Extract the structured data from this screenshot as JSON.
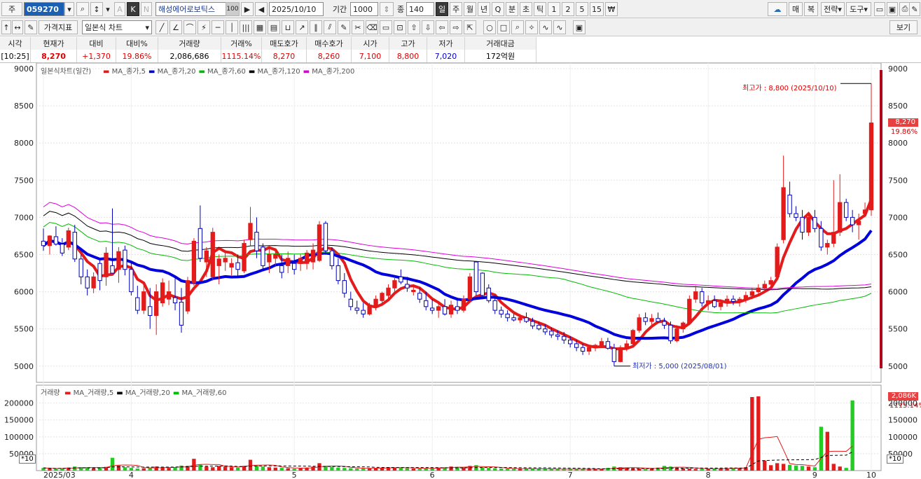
{
  "toolbar1": {
    "mode": "주",
    "code": "059270",
    "stock_name": "해성에어로보틱스",
    "name_badge": "100",
    "date": "2025/10/10",
    "period_label": "기간",
    "period_value": "1000",
    "count_label": "종",
    "count_value": "140",
    "intervals": [
      "일",
      "주",
      "월",
      "년",
      "분",
      "초",
      "틱",
      "1",
      "2",
      "5",
      "15"
    ],
    "active_interval": "일",
    "q_label": "Q",
    "right_buttons": [
      "매",
      "복",
      "전략",
      "도구"
    ]
  },
  "toolbar2": {
    "price_indicator_label": "가격지표",
    "chart_type_value": "일본식 차트",
    "view_label": "보기"
  },
  "quote": {
    "headers": [
      "시각",
      "현재가",
      "대비",
      "대비%",
      "거래량",
      "거래%",
      "매도호가",
      "매수호가",
      "시가",
      "고가",
      "저가",
      "거래대금"
    ],
    "values": [
      "[10:25]",
      "8,270",
      "+1,370",
      "19.86%",
      "2,086,686",
      "1115.14%",
      "8,270",
      "8,260",
      "7,100",
      "8,800",
      "7,020",
      "172억원"
    ],
    "colors": [
      "#000000",
      "#e00000",
      "#e00000",
      "#e00000",
      "#000000",
      "#e00000",
      "#e00000",
      "#e00000",
      "#e00000",
      "#e00000",
      "#0000d0",
      "#000000"
    ]
  },
  "price_chart": {
    "legend_title": "일본식차트(일간)",
    "ma_legend": [
      {
        "label": "MA_종가,5",
        "color": "#e41b1b"
      },
      {
        "label": "MA_종가,20",
        "color": "#0000dd"
      },
      {
        "label": "MA_종가,60",
        "color": "#00bb00"
      },
      {
        "label": "MA_종가,120",
        "color": "#000000"
      },
      {
        "label": "MA_종가,200",
        "color": "#dd00dd"
      }
    ],
    "high_annotation": "최고가 : 8,800 (2025/10/10)",
    "low_annotation": "최저가 : 5,000 (2025/08/01)",
    "current_price_tag": "8,270",
    "current_change_tag": "19.86%"
  },
  "volume_chart": {
    "legend_title": "거래량",
    "ma_legend": [
      {
        "label": "MA_거래량,5",
        "color": "#e41b1b"
      },
      {
        "label": "MA_거래량,20",
        "color": "#000000"
      },
      {
        "label": "MA_거래량,60",
        "color": "#00bb00"
      }
    ],
    "unit_badge": "*10",
    "current_volume_tag": "2,086K",
    "current_volume_pct": "1115.14%"
  },
  "chart_data": [
    {
      "type": "candlestick",
      "title": "일본식차트(일간)",
      "x_axis_labels": [
        "2025/03",
        "4",
        "5",
        "6",
        "7",
        "8",
        "9",
        "10"
      ],
      "ylim": [
        4800,
        9000
      ],
      "y_ticks": [
        5000,
        5500,
        6000,
        6500,
        7000,
        7500,
        8000,
        8500,
        9000
      ],
      "ohlc": [
        [
          6680,
          6850,
          6550,
          6620
        ],
        [
          6620,
          6760,
          6500,
          6750
        ],
        [
          6740,
          6880,
          6620,
          6640
        ],
        [
          6640,
          6720,
          6480,
          6520
        ],
        [
          6600,
          6860,
          6560,
          6820
        ],
        [
          6800,
          6900,
          6400,
          6440
        ],
        [
          6440,
          6500,
          6100,
          6200
        ],
        [
          6200,
          6300,
          5950,
          6050
        ],
        [
          6050,
          6260,
          5980,
          6200
        ],
        [
          6380,
          6420,
          6020,
          6150
        ],
        [
          6200,
          6600,
          6080,
          6520
        ],
        [
          6350,
          7120,
          6250,
          6250
        ],
        [
          6300,
          6600,
          6120,
          6540
        ],
        [
          6560,
          6620,
          6220,
          6300
        ],
        [
          6300,
          6400,
          5950,
          6000
        ],
        [
          5920,
          6080,
          5700,
          5750
        ],
        [
          5750,
          6100,
          5700,
          6000
        ],
        [
          5800,
          6050,
          5500,
          5680
        ],
        [
          5680,
          6100,
          5420,
          6000
        ],
        [
          5850,
          6180,
          5800,
          6120
        ],
        [
          5900,
          6150,
          5820,
          6000
        ],
        [
          5920,
          6200,
          5750,
          5850
        ],
        [
          5860,
          6050,
          5450,
          5550
        ],
        [
          5740,
          6200,
          5700,
          6150
        ],
        [
          6120,
          6720,
          6080,
          6680
        ],
        [
          6850,
          7160,
          6400,
          6450
        ],
        [
          6400,
          6600,
          6200,
          6550
        ],
        [
          6200,
          6860,
          6150,
          6800
        ],
        [
          6350,
          6500,
          6100,
          6440
        ],
        [
          6400,
          6520,
          6280,
          6450
        ],
        [
          6330,
          6450,
          6220,
          6380
        ],
        [
          6390,
          6500,
          6200,
          6300
        ],
        [
          6280,
          6700,
          6250,
          6650
        ],
        [
          6700,
          7140,
          6620,
          6920
        ],
        [
          6800,
          7000,
          6450,
          6550
        ],
        [
          6600,
          6650,
          6300,
          6350
        ],
        [
          6400,
          6600,
          6250,
          6500
        ],
        [
          6450,
          6550,
          6350,
          6500
        ],
        [
          6350,
          6500,
          6180,
          6260
        ],
        [
          6350,
          6540,
          6250,
          6450
        ],
        [
          6380,
          6500,
          6230,
          6300
        ],
        [
          6380,
          6500,
          6280,
          6450
        ],
        [
          6380,
          6560,
          6300,
          6520
        ],
        [
          6400,
          6650,
          6300,
          6560
        ],
        [
          6420,
          6950,
          6400,
          6900
        ],
        [
          6920,
          6950,
          6500,
          6550
        ],
        [
          6550,
          6600,
          6300,
          6350
        ],
        [
          6350,
          6450,
          6100,
          6150
        ],
        [
          6150,
          6250,
          5920,
          5980
        ],
        [
          5900,
          6000,
          5750,
          5800
        ],
        [
          5780,
          5880,
          5700,
          5750
        ],
        [
          5750,
          5850,
          5650,
          5700
        ],
        [
          5700,
          5850,
          5680,
          5820
        ],
        [
          5800,
          5950,
          5750,
          5900
        ],
        [
          5880,
          6000,
          5850,
          5980
        ],
        [
          5950,
          6100,
          5900,
          6050
        ],
        [
          6050,
          6200,
          6000,
          6150
        ],
        [
          6200,
          6300,
          6100,
          6130
        ],
        [
          6100,
          6200,
          6000,
          6050
        ],
        [
          6000,
          6100,
          5950,
          6020
        ],
        [
          5980,
          6050,
          5850,
          5900
        ],
        [
          5880,
          6000,
          5750,
          5800
        ],
        [
          5780,
          5900,
          5700,
          5750
        ],
        [
          5750,
          5850,
          5650,
          5800
        ],
        [
          5800,
          5900,
          5680,
          5700
        ],
        [
          5700,
          5880,
          5650,
          5820
        ],
        [
          5800,
          5900,
          5700,
          5750
        ],
        [
          5750,
          5950,
          5720,
          5900
        ],
        [
          5900,
          6250,
          5880,
          6200
        ],
        [
          6400,
          6410,
          5950,
          6000
        ],
        [
          6250,
          6260,
          5900,
          5950
        ],
        [
          6050,
          6100,
          5850,
          5880
        ],
        [
          5880,
          5950,
          5700,
          5750
        ],
        [
          5750,
          5800,
          5650,
          5700
        ],
        [
          5700,
          5750,
          5600,
          5650
        ],
        [
          5650,
          5700,
          5600,
          5620
        ],
        [
          5620,
          5700,
          5580,
          5650
        ],
        [
          5650,
          5720,
          5580,
          5600
        ],
        [
          5600,
          5650,
          5500,
          5540
        ],
        [
          5550,
          5600,
          5480,
          5500
        ],
        [
          5500,
          5560,
          5420,
          5460
        ],
        [
          5470,
          5520,
          5380,
          5420
        ],
        [
          5420,
          5480,
          5350,
          5400
        ],
        [
          5400,
          5460,
          5300,
          5350
        ],
        [
          5350,
          5400,
          5250,
          5300
        ],
        [
          5300,
          5350,
          5200,
          5250
        ],
        [
          5250,
          5300,
          5150,
          5200
        ],
        [
          5200,
          5280,
          5150,
          5250
        ],
        [
          5250,
          5300,
          5200,
          5280
        ],
        [
          5280,
          5380,
          5250,
          5330
        ],
        [
          5330,
          5380,
          5220,
          5240
        ],
        [
          5240,
          5300,
          5000,
          5060
        ],
        [
          5060,
          5280,
          5050,
          5250
        ],
        [
          5250,
          5350,
          5200,
          5300
        ],
        [
          5300,
          5500,
          5280,
          5480
        ],
        [
          5480,
          5700,
          5450,
          5650
        ],
        [
          5650,
          5720,
          5550,
          5600
        ],
        [
          5600,
          5700,
          5550,
          5640
        ],
        [
          5640,
          5720,
          5580,
          5600
        ],
        [
          5600,
          5650,
          5500,
          5550
        ],
        [
          5550,
          5600,
          5300,
          5340
        ],
        [
          5340,
          5550,
          5320,
          5500
        ],
        [
          5500,
          5600,
          5450,
          5580
        ],
        [
          5580,
          5950,
          5550,
          5900
        ],
        [
          5900,
          6080,
          5850,
          6000
        ],
        [
          6000,
          6050,
          5800,
          5850
        ],
        [
          5850,
          5950,
          5750,
          5880
        ],
        [
          5880,
          5950,
          5780,
          5800
        ],
        [
          5800,
          5900,
          5750,
          5850
        ],
        [
          5850,
          5950,
          5800,
          5900
        ],
        [
          5900,
          5950,
          5820,
          5870
        ],
        [
          5870,
          5930,
          5800,
          5900
        ],
        [
          5900,
          6000,
          5850,
          5950
        ],
        [
          5950,
          6050,
          5900,
          6000
        ],
        [
          6000,
          6100,
          5950,
          6050
        ],
        [
          6050,
          6150,
          6000,
          6100
        ],
        [
          6100,
          6200,
          6050,
          6150
        ],
        [
          6200,
          6650,
          6150,
          6600
        ],
        [
          6700,
          7830,
          6650,
          7400
        ],
        [
          7300,
          7480,
          7000,
          7050
        ],
        [
          7050,
          7150,
          6950,
          7000
        ],
        [
          7000,
          7100,
          6700,
          6800
        ],
        [
          6800,
          7050,
          6750,
          7000
        ],
        [
          7000,
          7100,
          6800,
          6850
        ],
        [
          6850,
          6950,
          6550,
          6600
        ],
        [
          6600,
          6700,
          6500,
          6650
        ],
        [
          6650,
          7500,
          6600,
          6800
        ],
        [
          6800,
          7580,
          6750,
          7200
        ],
        [
          7200,
          7250,
          6950,
          7000
        ],
        [
          7000,
          7100,
          6800,
          6900
        ],
        [
          6900,
          7050,
          6700,
          6950
        ],
        [
          7050,
          7200,
          7000,
          7100
        ],
        [
          7100,
          8800,
          7020,
          8270
        ]
      ],
      "ma_lines": [
        "MA_종가,5",
        "MA_종가,20",
        "MA_종가,60",
        "MA_종가,120",
        "MA_종가,200"
      ]
    },
    {
      "type": "bar",
      "title": "거래량",
      "unit": "*10",
      "ylim": [
        0,
        220000
      ],
      "y_ticks": [
        50000,
        100000,
        150000,
        200000
      ],
      "values": [
        8000,
        6000,
        5000,
        7000,
        9000,
        12000,
        10000,
        8000,
        7000,
        9000,
        11000,
        38000,
        15000,
        10000,
        8000,
        6000,
        7000,
        9000,
        12000,
        10000,
        8000,
        9000,
        15000,
        14000,
        35000,
        18000,
        12000,
        10000,
        14000,
        12000,
        10000,
        9000,
        14000,
        32000,
        15000,
        12000,
        10000,
        9000,
        8000,
        7000,
        6000,
        7000,
        9000,
        12000,
        22000,
        14000,
        11000,
        9000,
        8000,
        7000,
        6000,
        6000,
        7000,
        8000,
        9000,
        10000,
        9000,
        8000,
        7000,
        6000,
        6000,
        7000,
        8000,
        9000,
        10000,
        12000,
        11000,
        9000,
        14000,
        16000,
        10000,
        8000,
        7000,
        6000,
        6000,
        5000,
        5000,
        6000,
        5000,
        5000,
        5000,
        4000,
        4000,
        4000,
        5000,
        5000,
        4000,
        4000,
        5000,
        5000,
        8000,
        12000,
        10000,
        8000,
        7000,
        6000,
        5000,
        7000,
        9000,
        14000,
        12000,
        9000,
        7000,
        6000,
        5000,
        5000,
        5000,
        6000,
        6000,
        7000,
        8000,
        8000,
        10000,
        218000,
        220000,
        30000,
        16000,
        22000,
        20000,
        17000,
        15000,
        14000,
        12000,
        10000,
        130000,
        115000,
        20000,
        12000,
        8000,
        208000
      ],
      "ma_lines": [
        "MA_거래량,5",
        "MA_거래량,20",
        "MA_거래량,60"
      ]
    }
  ]
}
